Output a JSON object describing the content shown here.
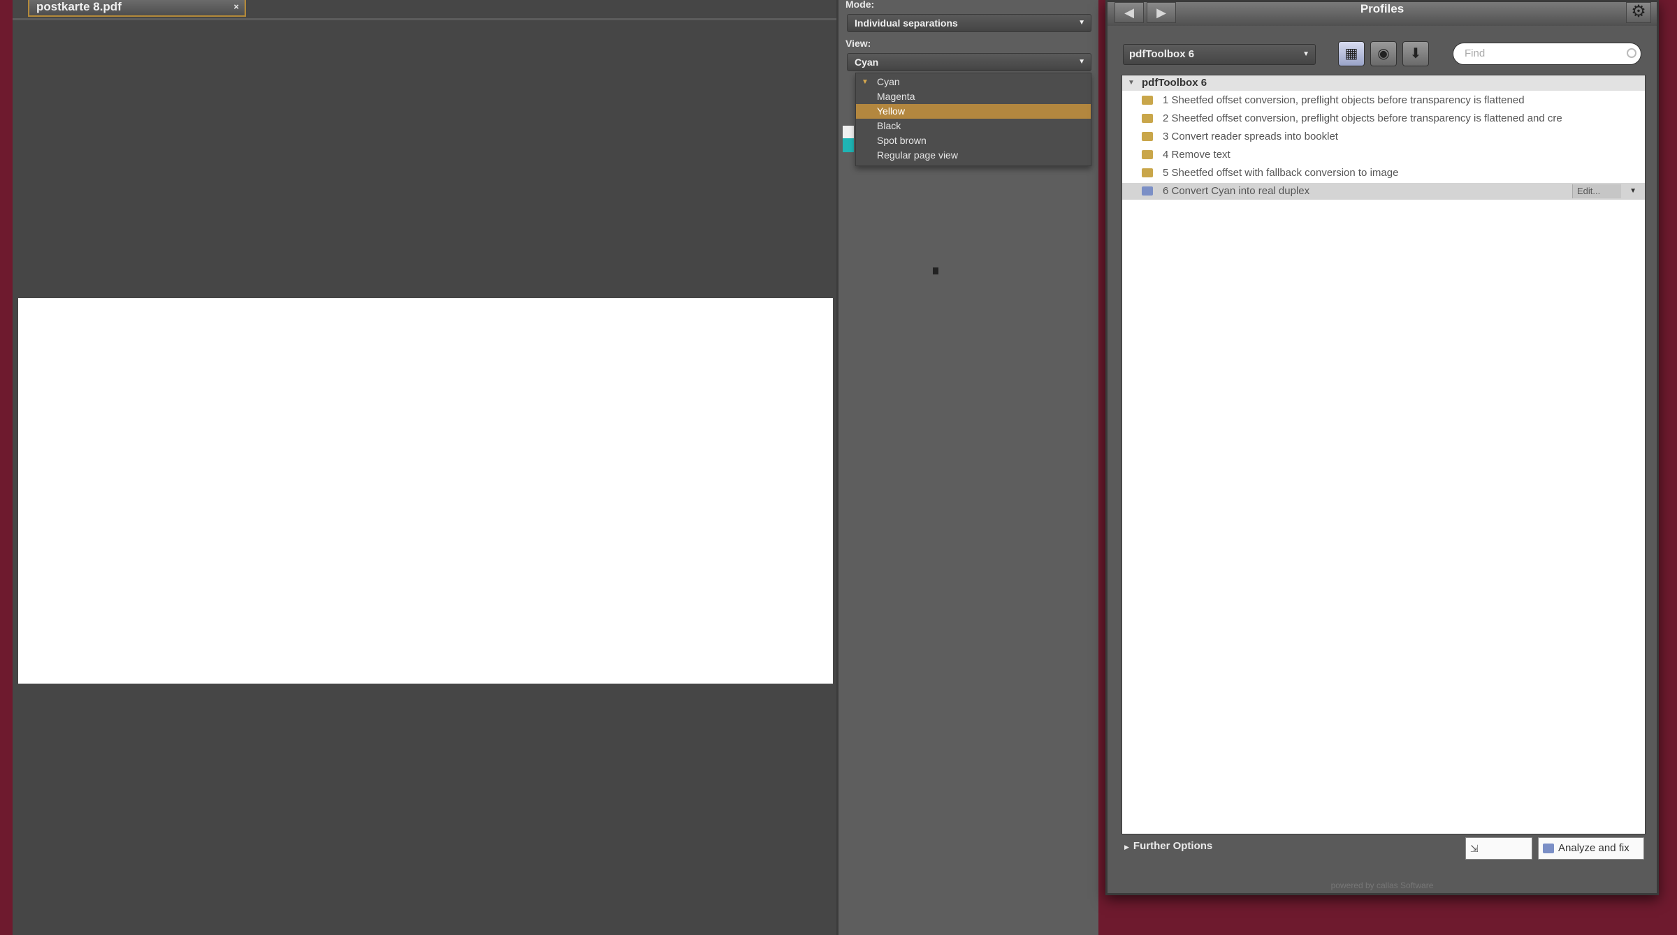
{
  "document": {
    "tab_title": "postkarte 8.pdf",
    "close_glyph": "×"
  },
  "preview": {
    "mode_label": "Mode:",
    "mode_value": "Individual separations",
    "view_label": "View:",
    "view_value": "Cyan",
    "view_options": [
      "Cyan",
      "Magenta",
      "Yellow",
      "Black",
      "Spot brown",
      "Regular page view"
    ],
    "checked_option": "Cyan",
    "highlighted_option": "Yellow",
    "swatch_colors": [
      "#f0f0f0",
      "#1fb5b5"
    ]
  },
  "profiles": {
    "window_title": "Profiles",
    "library_select": "pdfToolbox 6",
    "search_placeholder": "Find",
    "group_name": "pdfToolbox 6",
    "items": [
      {
        "label": "1 Sheetfed offset conversion, preflight objects before transparency is flattened",
        "icon": "folder-icon"
      },
      {
        "label": "2 Sheetfed offset conversion, preflight objects before transparency is flattened and cre",
        "icon": "folder-icon"
      },
      {
        "label": "3 Convert reader spreads into booklet",
        "icon": "folder-icon"
      },
      {
        "label": "4 Remove text",
        "icon": "folder-icon"
      },
      {
        "label": "5 Sheetfed offset with fallback conversion to image",
        "icon": "folder-icon"
      },
      {
        "label": "6 Convert Cyan into real duplex",
        "icon": "profile-icon"
      }
    ],
    "selected_index": 5,
    "edit_label": "Edit...",
    "further_options": "Further Options",
    "analyze_button": "Analyze and fix",
    "footer": "powered by callas Software"
  },
  "colors": {
    "accent_highlight": "#b3873f",
    "background_desktop": "#6e1a2e"
  }
}
